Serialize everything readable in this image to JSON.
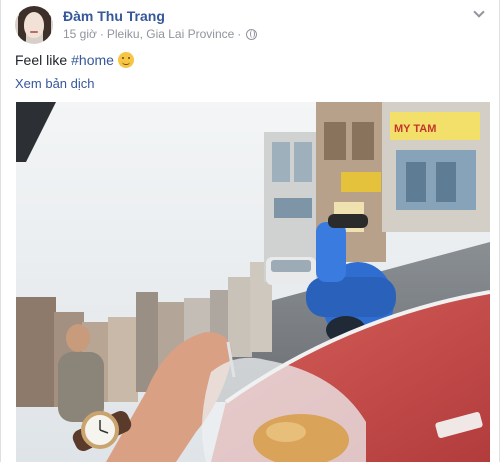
{
  "post": {
    "author": "Đàm Thu Trang",
    "time": "15 giờ",
    "separator": "·",
    "location": "Pleiku, Gia Lai Province",
    "separator2": "·",
    "status_prefix": "Feel like",
    "hashtag": "#home",
    "translate_link": "Xem bản dịch"
  },
  "photo": {
    "signs": [
      "MY TAM"
    ]
  },
  "icons": {
    "privacy": "globe-icon",
    "menu": "chevron-down-icon",
    "emoji": "smiling-face-icon"
  },
  "colors": {
    "link": "#365899",
    "meta": "#90949c",
    "dashboard": "#c74a48",
    "scooter": "#2f6ed0"
  }
}
